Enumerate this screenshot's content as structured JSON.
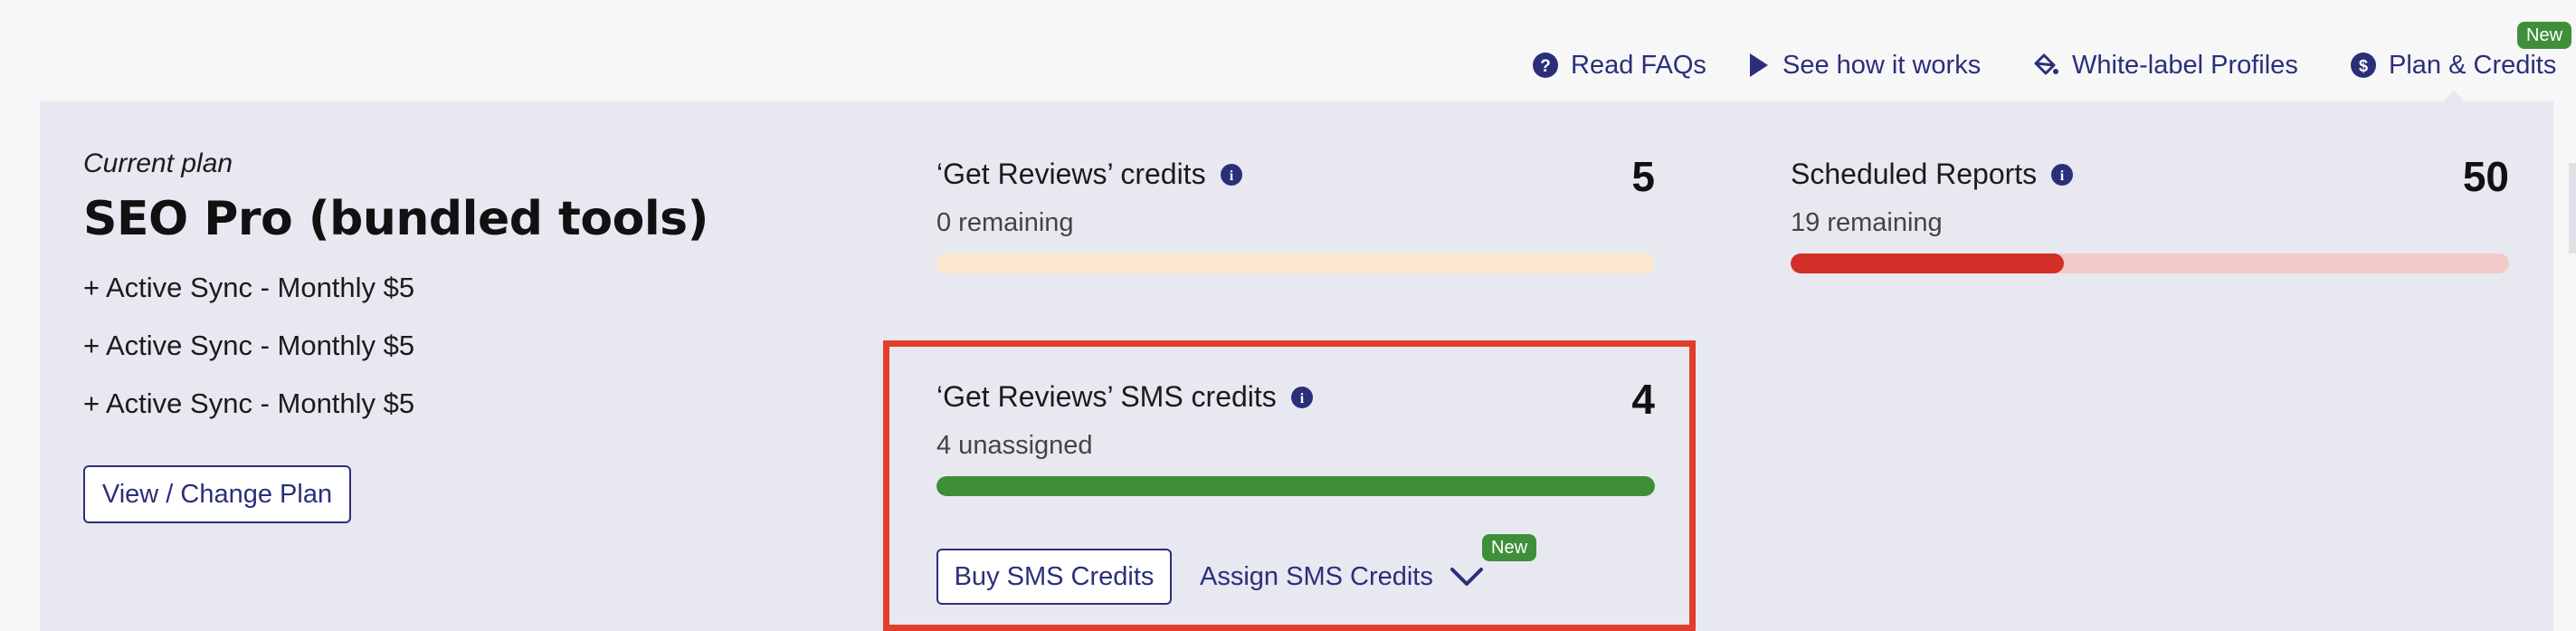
{
  "nav": {
    "read_faqs": "Read FAQs",
    "see_how": "See how it works",
    "white_label": "White-label Profiles",
    "plan_credits": "Plan & Credits",
    "plan_credits_badge": "New"
  },
  "plan": {
    "caption": "Current plan",
    "name": "SEO Pro (bundled tools)",
    "addons": [
      "+ Active Sync - Monthly $5",
      "+ Active Sync - Monthly $5",
      "+ Active Sync - Monthly $5"
    ],
    "change_button": "View / Change Plan"
  },
  "credits": {
    "reviews": {
      "title": "‘Get Reviews’ credits",
      "count": "5",
      "subtitle": "0 remaining",
      "fill_fraction": 0
    },
    "reports": {
      "title": "Scheduled Reports",
      "count": "50",
      "subtitle": "19 remaining",
      "fill_fraction": 0.38
    },
    "sms": {
      "title": "‘Get Reviews’ SMS credits",
      "count": "4",
      "subtitle": "4 unassigned",
      "fill_fraction": 1,
      "buy_button": "Buy SMS Credits",
      "assign_link": "Assign SMS Credits",
      "assign_badge": "New"
    }
  },
  "colors": {
    "accent": "#2b2f7a",
    "green": "#3f8f3a",
    "red": "#d12f27",
    "red_track": "#f4c9c9",
    "orange_track": "#fbe8cf",
    "highlight": "#e23e2b",
    "panel_bg": "#e8e8f1"
  },
  "icons": {
    "read_faqs": "question-circle-icon",
    "see_how": "play-icon",
    "white_label": "paint-bucket-icon",
    "plan_credits": "dollar-circle-icon",
    "info": "info-circle-icon",
    "assign_chevron": "chevron-down-icon"
  }
}
